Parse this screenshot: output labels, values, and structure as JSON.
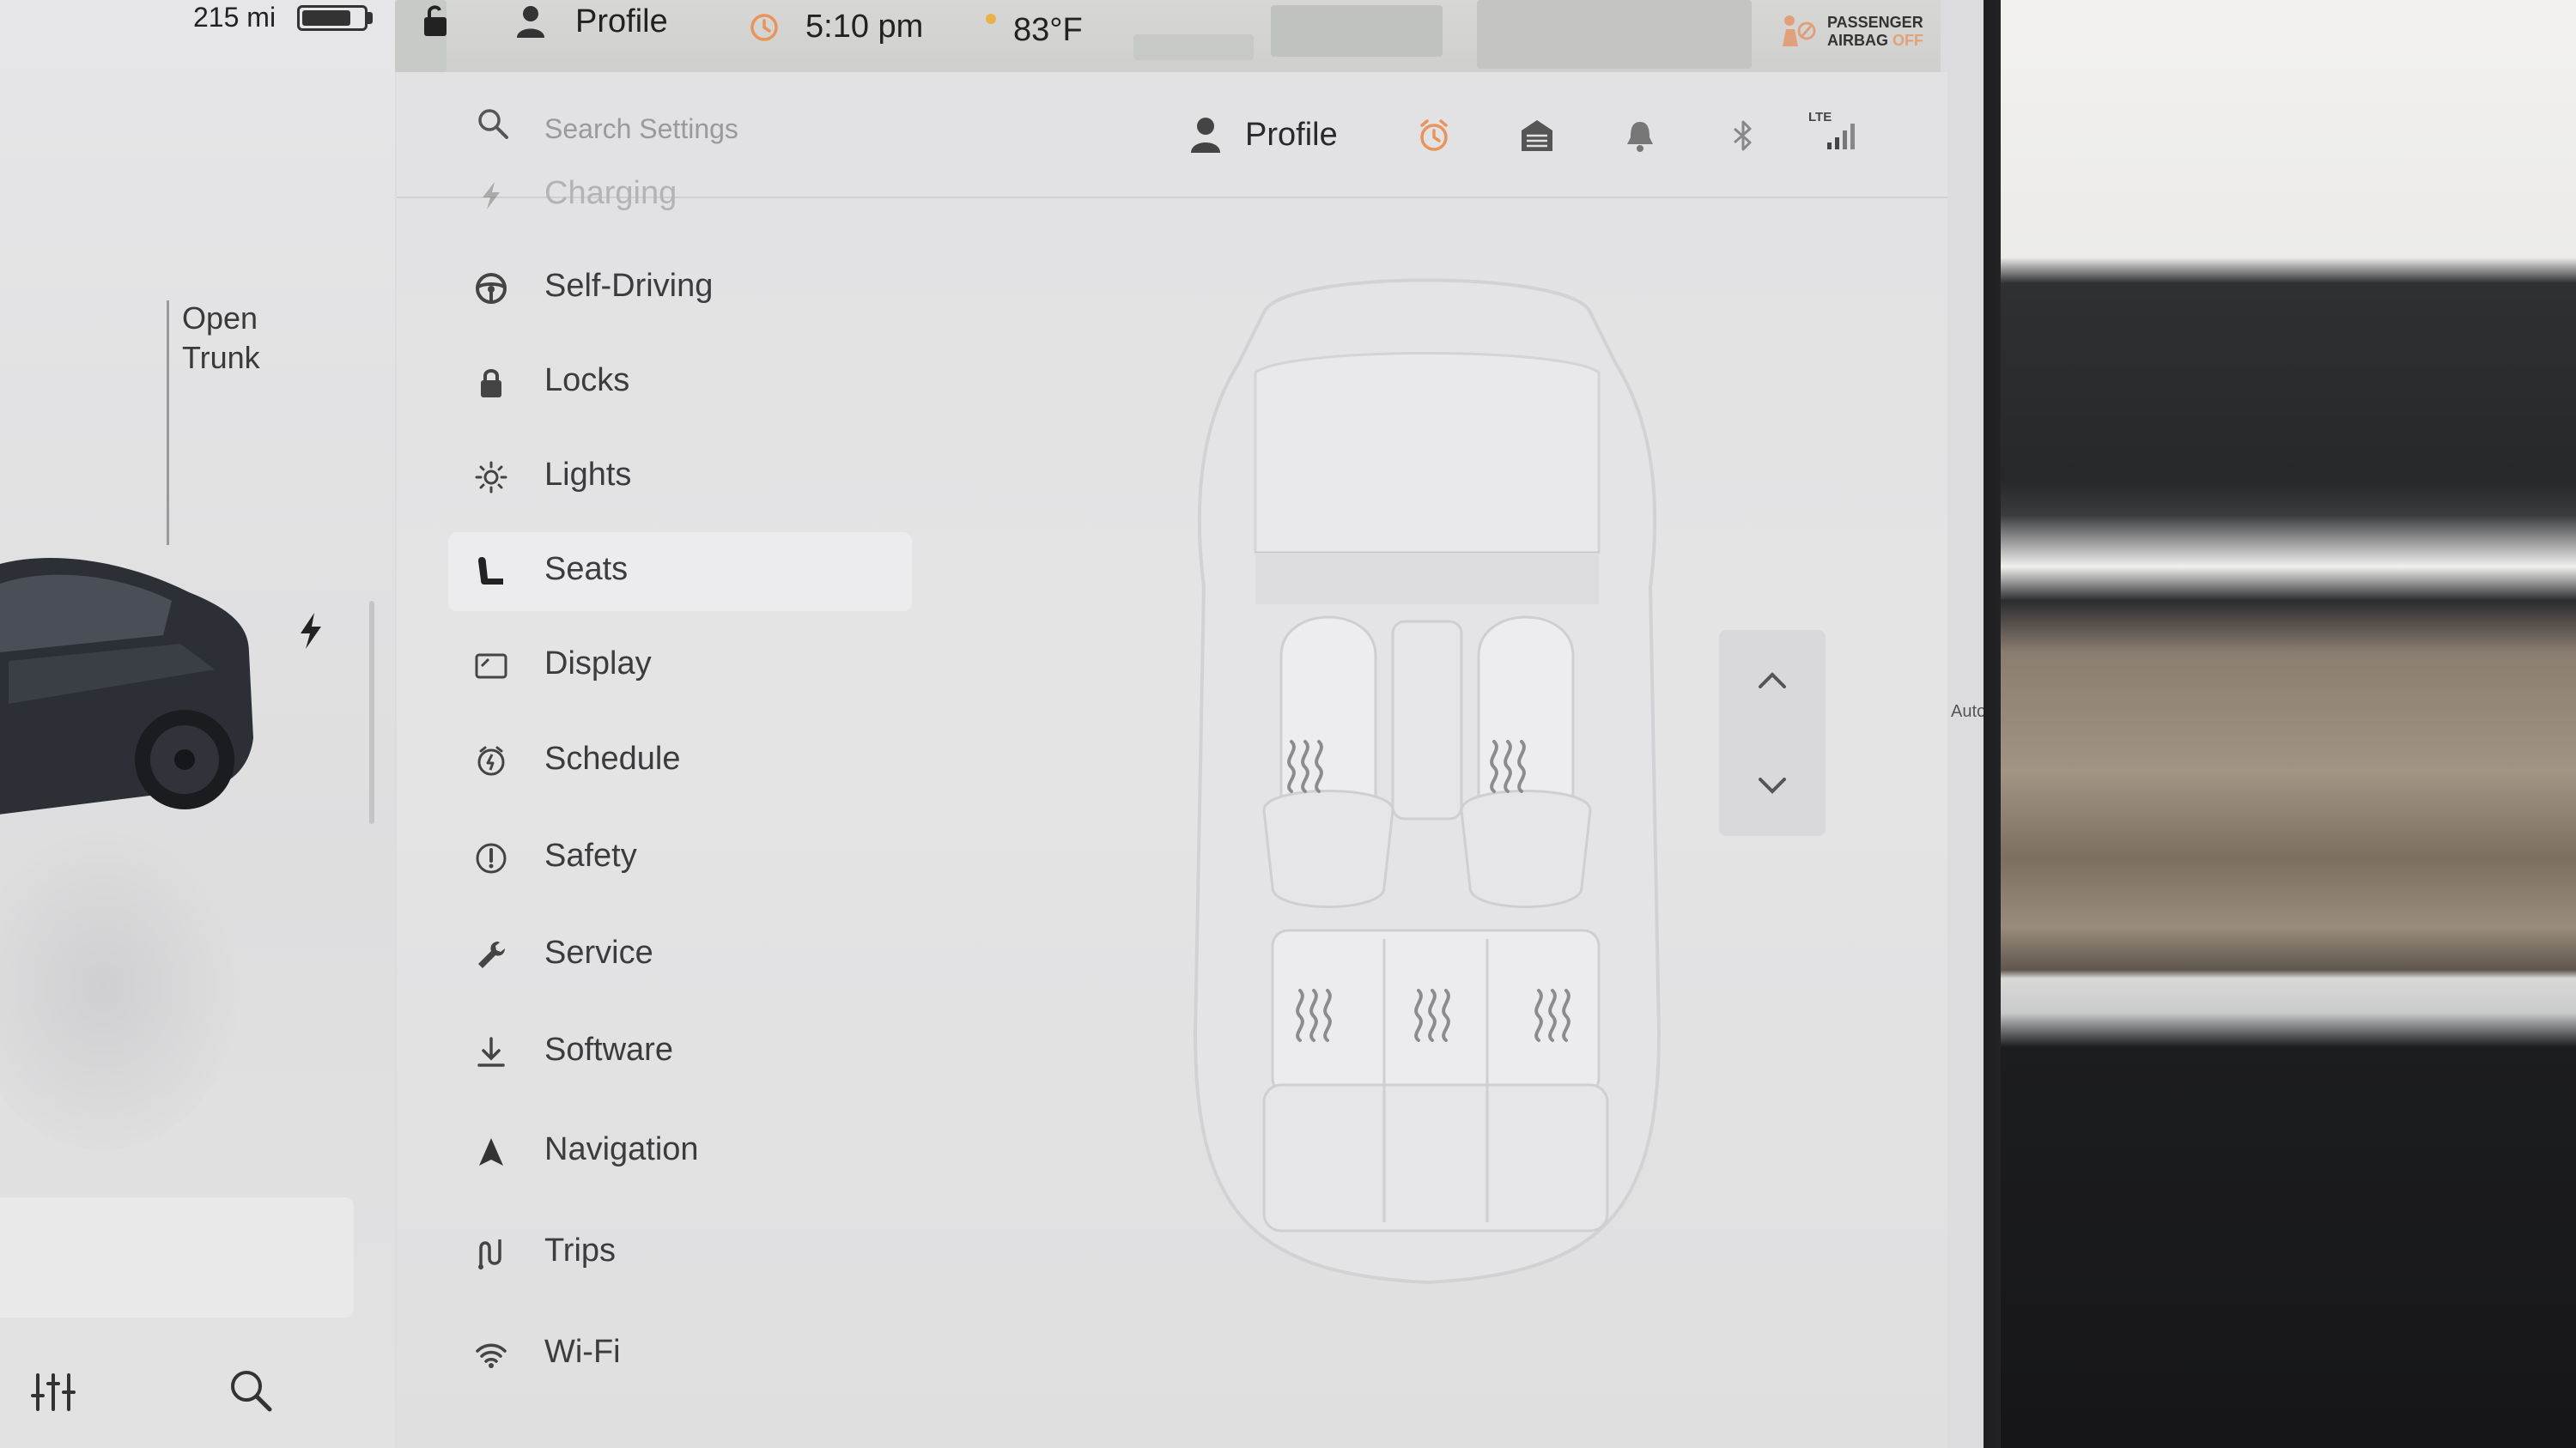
{
  "status_bar": {
    "range": "215 mi",
    "battery_level": 0.8,
    "profile_label": "Profile",
    "time": "5:10 pm",
    "temperature": "83°F",
    "airbag_line1": "PASSENGER",
    "airbag_line2": "AIRBAG",
    "airbag_status": "OFF",
    "airbag_status_color": "#e0a17a"
  },
  "car_panel": {
    "open_trunk_label": "Open\nTrunk",
    "charge_icon": "lightning-icon",
    "bottom_icons": [
      "equalizer-icon",
      "search-icon"
    ]
  },
  "settings_header": {
    "search_placeholder": "Search Settings",
    "profile_label": "Profile",
    "icons": [
      "alarm-clock-icon",
      "garage-icon",
      "bell-icon",
      "bluetooth-icon",
      "lte-signal-icon"
    ],
    "lte_label": "LTE",
    "alarm_color": "#e8945a"
  },
  "menu": {
    "items": [
      {
        "label": "Charging",
        "icon": "charging-icon"
      },
      {
        "label": "Self-Driving",
        "icon": "steering-wheel-icon"
      },
      {
        "label": "Locks",
        "icon": "lock-icon"
      },
      {
        "label": "Lights",
        "icon": "light-bulb-icon"
      },
      {
        "label": "Seats",
        "icon": "seat-icon"
      },
      {
        "label": "Display",
        "icon": "display-icon"
      },
      {
        "label": "Schedule",
        "icon": "schedule-icon"
      },
      {
        "label": "Safety",
        "icon": "alert-icon"
      },
      {
        "label": "Service",
        "icon": "wrench-icon"
      },
      {
        "label": "Software",
        "icon": "download-icon"
      },
      {
        "label": "Navigation",
        "icon": "navigation-arrow-icon"
      },
      {
        "label": "Trips",
        "icon": "trips-icon"
      },
      {
        "label": "Wi-Fi",
        "icon": "wifi-icon"
      }
    ],
    "selected": "Seats"
  },
  "seats": {
    "driver_heat_label": "",
    "passenger_heat_label": "Auto",
    "rear_seats": [
      "rear-left-seat-heater",
      "rear-center-seat-heater",
      "rear-right-seat-heater"
    ]
  }
}
